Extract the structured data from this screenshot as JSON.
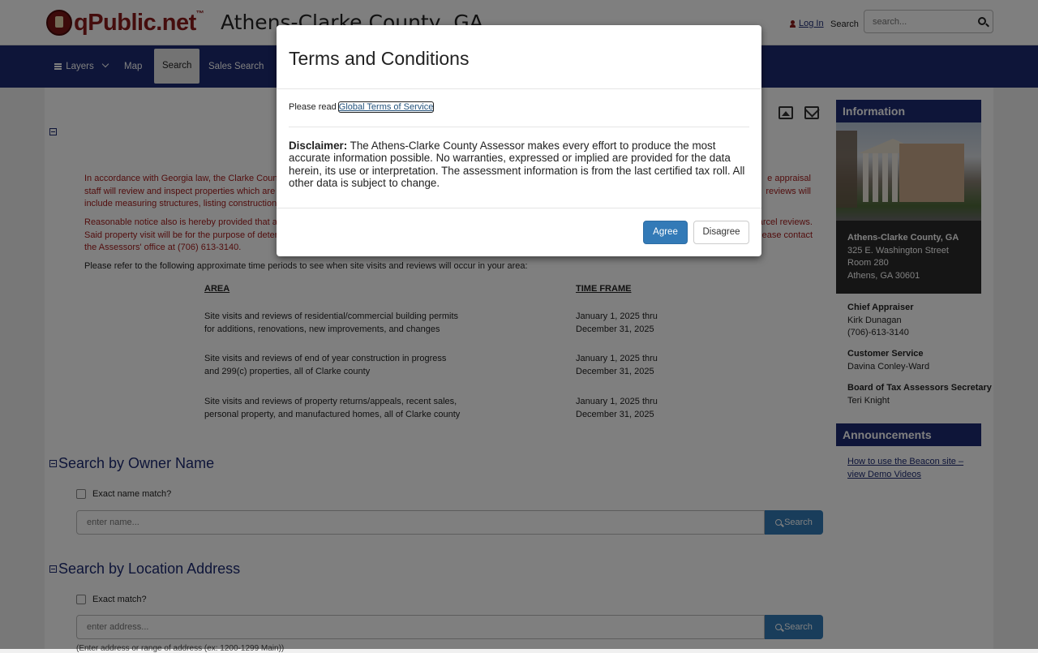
{
  "header": {
    "logo_text": "qPublic.net",
    "logo_tm": "™",
    "county_title": "Athens-Clarke County, GA",
    "login_label": "Log In",
    "search_label": "Search",
    "search_placeholder": "search..."
  },
  "nav": {
    "items": [
      {
        "label": "Layers"
      },
      {
        "label": "Map"
      },
      {
        "label": "Search"
      },
      {
        "label": "Sales Search"
      }
    ]
  },
  "notice": {
    "para1_lines": [
      "In accordance with Georgia law, the Clarke County",
      "staff will review and inspect properties which are",
      "include measuring structures, listing construction"
    ],
    "para1_right": [
      "e appraisal",
      "reviews will"
    ],
    "para2_lines": [
      "Reasonable notice also is hereby provided that an",
      "Said property visit will be for the purpose of deter",
      "the Assessors' office at (706) 613-3140."
    ],
    "para2_right": [
      "arcel reviews.",
      "ease contact"
    ],
    "refer_text": "Please refer to the following approximate time periods to see when site visits and reviews will occur in your area:"
  },
  "schedule": {
    "area_header": "AREA",
    "time_header": "TIME FRAME",
    "rows": [
      {
        "area": [
          "Site visits and reviews of residential/commercial building permits",
          "for additions, renovations, new improvements, and changes"
        ],
        "time": [
          "January 1, 2025 thru",
          "December 31, 2025"
        ]
      },
      {
        "area": [
          "Site visits and reviews of end of year construction in progress",
          "and 299(c) properties, all of Clarke county"
        ],
        "time": [
          "January 1, 2025 thru",
          "December 31, 2025"
        ]
      },
      {
        "area": [
          "Site visits and reviews of property returns/appeals, recent sales,",
          "personal property, and manufactured homes, all of Clarke county"
        ],
        "time": [
          "January 1, 2025 thru",
          "December 31, 2025"
        ]
      }
    ]
  },
  "owner_search": {
    "title": "Search by Owner Name",
    "checkbox_label": "Exact name match?",
    "placeholder": "enter name...",
    "button_label": "Search"
  },
  "address_search": {
    "title": "Search by Location Address",
    "checkbox_label": "Exact match?",
    "placeholder": "enter address...",
    "button_label": "Search",
    "helper": "(Enter address or range of address (ex: 1200-1299 Main))"
  },
  "sidebar": {
    "info_title": "Information",
    "address": {
      "name": "Athens-Clarke County, GA",
      "street": "325 E. Washington Street",
      "room": "Room 280",
      "city": "Athens, GA 30601"
    },
    "chief_label": "Chief Appraiser",
    "chief_name": "Kirk Dunagan",
    "chief_phone": "(706)-613-3140",
    "cs_label": "Customer Service",
    "cs_name": "Davina Conley-Ward",
    "board_label": "Board of Tax Assessors Secretary",
    "board_name": "Teri Knight",
    "announcements_title": "Announcements",
    "announcement_link": "How to use the Beacon site – view Demo Videos"
  },
  "modal": {
    "title": "Terms and Conditions",
    "read_prefix": "Please read ",
    "read_link": "Global Terms of Service",
    "disclaimer_label": "Disclaimer:",
    "disclaimer_text": " The Athens-Clarke County Assessor makes every effort to produce the most accurate information possible. No warranties, expressed or implied are provided for the data herein, its use or interpretation. The assessment information is from the last certified tax roll. All other data is subject to change.",
    "agree_label": "Agree",
    "disagree_label": "Disagree"
  }
}
